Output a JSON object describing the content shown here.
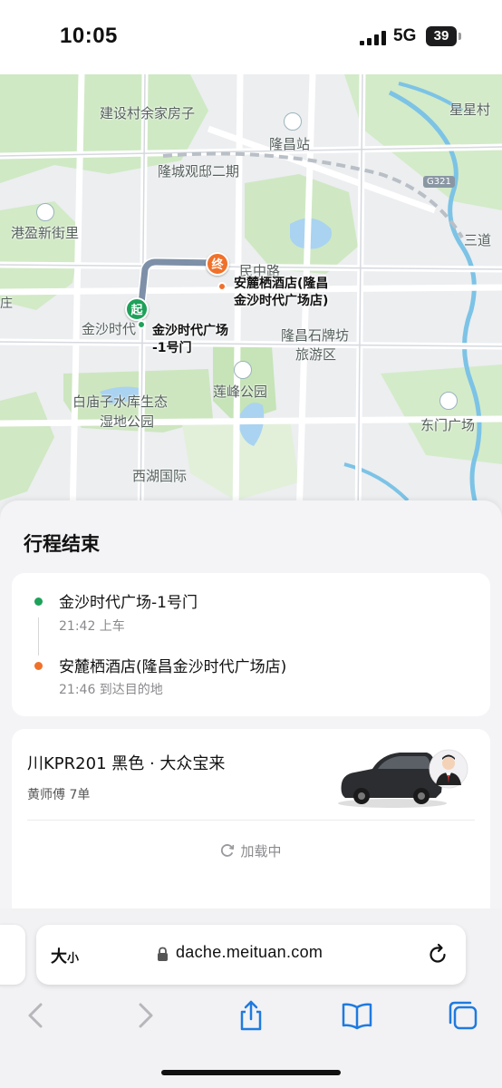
{
  "status_bar": {
    "time": "10:05",
    "network": "5G",
    "battery": "39",
    "signal_icon": "cellular-signal-icon"
  },
  "map": {
    "labels": {
      "jianshe": "建设村余家房子",
      "xingxing": "星星村",
      "longchang_station": "隆昌站",
      "longcheng": "隆城观邸二期",
      "g321": "G321",
      "gangying": "港盈新街里",
      "sandao": "三道",
      "minzhong": "民中路",
      "jinsha": "金沙时代",
      "shipaifang_1": "隆昌石牌坊",
      "shipaifang_2": "旅游区",
      "lianfeng": "莲峰公园",
      "baimiao_1": "白庙子水库生态",
      "baimiao_2": "湿地公园",
      "dongmen": "东门广场",
      "xihu": "西湖国际",
      "left_edge": "庄"
    },
    "start_marker": "起",
    "end_marker": "终",
    "start_poi": {
      "line1": "金沙时代广场",
      "line2": "-1号门"
    },
    "end_poi": {
      "line1": "安麓栖酒店(隆昌",
      "line2": "金沙时代广场店)"
    },
    "colors": {
      "start": "#1ea15a",
      "end": "#f0712a",
      "route": "#7d90a8"
    }
  },
  "trip": {
    "title": "行程结束",
    "pickup": {
      "place": "金沙时代广场-1号门",
      "time": "21:42 上车"
    },
    "dropoff": {
      "place": "安麓栖酒店(隆昌金沙时代广场店)",
      "time": "21:46 到达目的地"
    }
  },
  "car": {
    "title": "川KPR201 黑色 · 大众宝来",
    "driver": "黄师傅  7单",
    "loading": "加载中"
  },
  "browser": {
    "text_size_big": "大",
    "text_size_small": "小",
    "url": "dache.meituan.com",
    "icons": [
      "back-icon",
      "forward-icon",
      "share-icon",
      "bookmarks-icon",
      "tabs-icon"
    ]
  }
}
